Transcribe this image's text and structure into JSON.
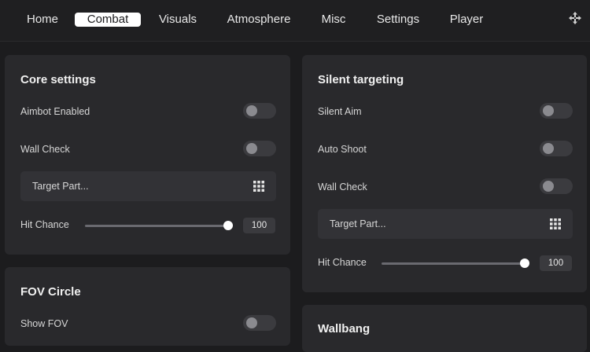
{
  "nav": {
    "tabs": [
      {
        "label": "Home"
      },
      {
        "label": "Combat"
      },
      {
        "label": "Visuals"
      },
      {
        "label": "Atmosphere"
      },
      {
        "label": "Misc"
      },
      {
        "label": "Settings"
      },
      {
        "label": "Player"
      }
    ],
    "active_tab": "Combat",
    "move_icon": "move-icon"
  },
  "core_settings": {
    "title": "Core settings",
    "aimbot_label": "Aimbot Enabled",
    "aimbot_on": false,
    "wallcheck_label": "Wall Check",
    "wallcheck_on": false,
    "target_part_label": "Target Part...",
    "hit_chance_label": "Hit Chance",
    "hit_chance_value": "100"
  },
  "fov_circle": {
    "title": "FOV Circle",
    "show_fov_label": "Show FOV",
    "show_fov_on": false
  },
  "silent_targeting": {
    "title": "Silent targeting",
    "silent_aim_label": "Silent Aim",
    "silent_aim_on": false,
    "auto_shoot_label": "Auto Shoot",
    "auto_shoot_on": false,
    "wallcheck_label": "Wall Check",
    "wallcheck_on": false,
    "target_part_label": "Target Part...",
    "hit_chance_label": "Hit Chance",
    "hit_chance_value": "100"
  },
  "wallbang": {
    "title": "Wallbang"
  },
  "colors": {
    "background": "#1c1c1e",
    "panel": "#29292c",
    "toggle_off": "#3b3b3f",
    "accent_active_tab": "#ffffff"
  }
}
